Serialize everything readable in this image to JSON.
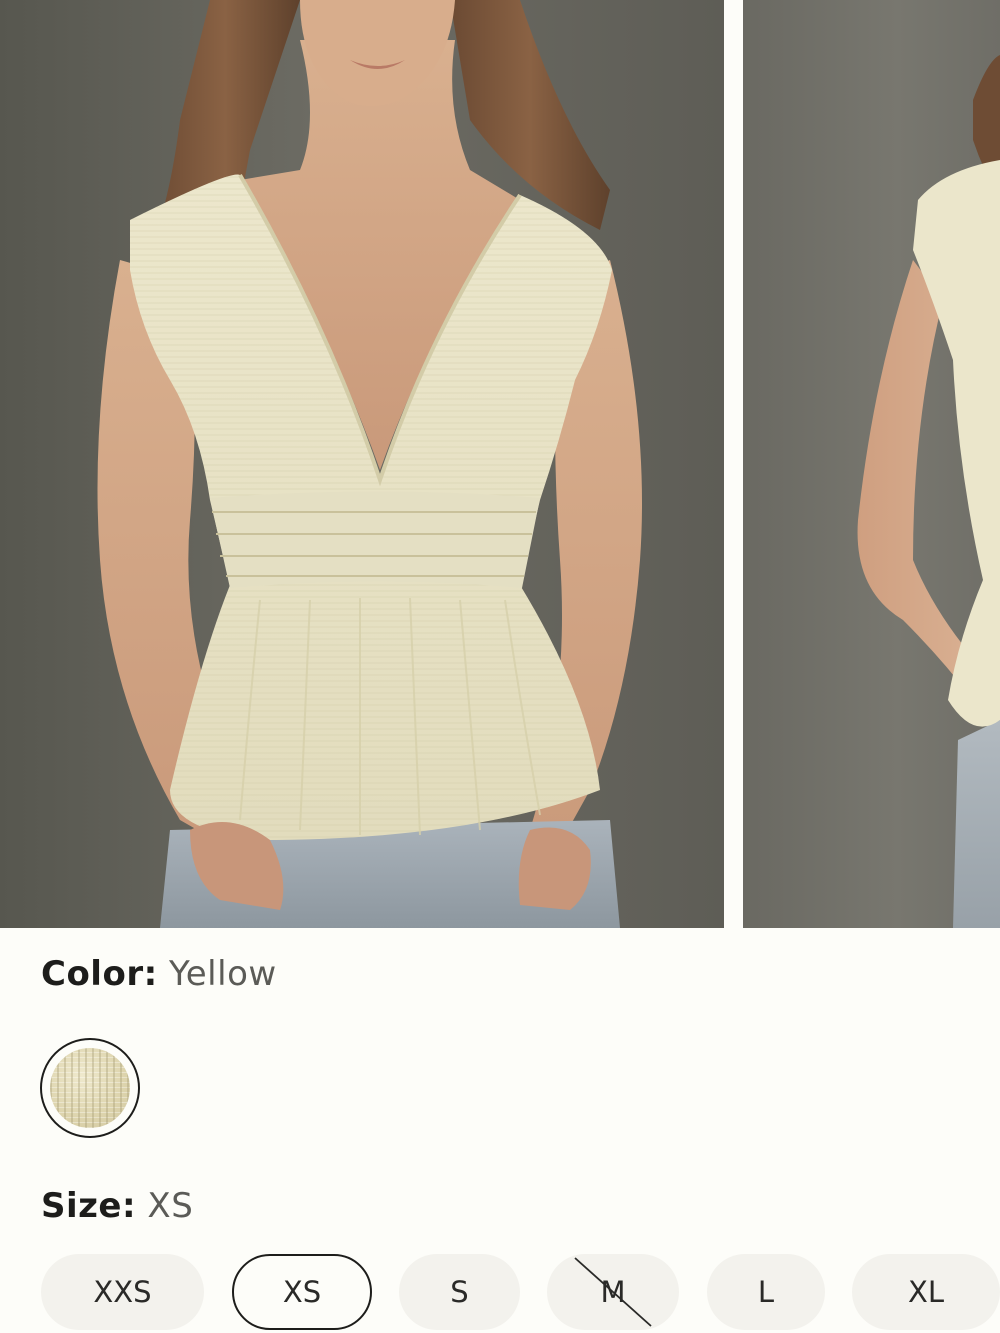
{
  "gallery": {
    "images": [
      {
        "alt": "model wearing yellow smocked-waist top, front view",
        "icon": "product-photo-front"
      },
      {
        "alt": "model wearing yellow smocked-waist top, side view",
        "icon": "product-photo-side"
      }
    ]
  },
  "color": {
    "label": "Color:",
    "value": "Yellow",
    "swatches": [
      {
        "name": "Yellow",
        "selected": true,
        "hex": "#ddd4ad"
      }
    ]
  },
  "size": {
    "label": "Size:",
    "value": "XS",
    "options": [
      {
        "label": "XXS",
        "selected": false,
        "available": true
      },
      {
        "label": "XS",
        "selected": true,
        "available": true
      },
      {
        "label": "S",
        "selected": false,
        "available": true
      },
      {
        "label": "M",
        "selected": false,
        "available": false
      },
      {
        "label": "L",
        "selected": false,
        "available": true
      },
      {
        "label": "XL",
        "selected": false,
        "available": true
      }
    ]
  },
  "colors": {
    "background": "#fdfdf9",
    "text": "#1d1d1b",
    "muted": "#5b5b57",
    "chip": "#f3f2ed",
    "garment": "#e9e4c8"
  }
}
